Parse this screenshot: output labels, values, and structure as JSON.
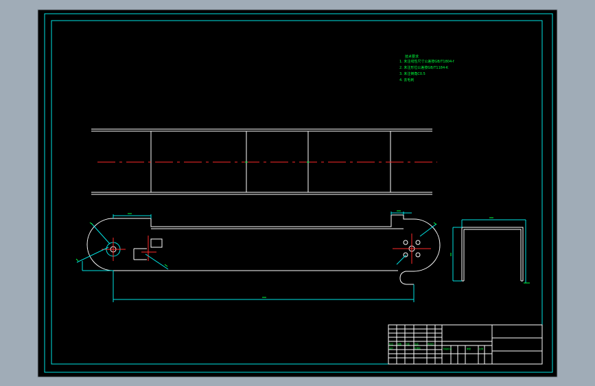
{
  "drawing": {
    "background_color": "#a0acb7",
    "sheet_color": "#000000",
    "geometry_color": "#ffffff",
    "frame_color": "#00e5e5",
    "annotation_color": "#00ff3c",
    "centerline_color": "#ff2a2a"
  },
  "notes": {
    "title": "技术要求",
    "items": [
      "1. 未注线性尺寸公差按GB/T1804-f",
      "2. 未注形位公差按GB/T1184-K",
      "3. 未注倒角C0.5",
      "4. 去毛刺"
    ]
  },
  "title_block": {
    "cells": [
      "标记",
      "处数",
      "分区",
      "签名",
      "年月日",
      "设计",
      "标准化",
      "阶段标记",
      "重量",
      "比例"
    ]
  },
  "icons": {
    "hole_marks": "circle-hole-icon",
    "centerline": "dash-dot-centerline-icon"
  }
}
